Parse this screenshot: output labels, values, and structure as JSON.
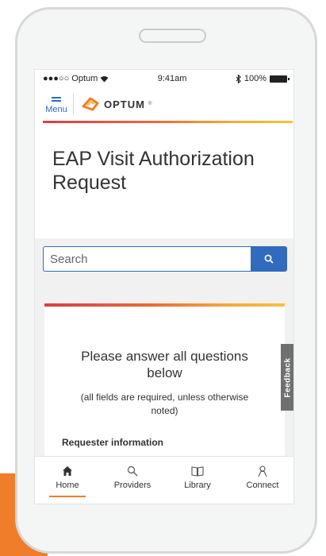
{
  "status_bar": {
    "carrier": "●●●○○ Optum",
    "time": "9:41am",
    "battery": "100%"
  },
  "header": {
    "menu_label": "Menu",
    "logo_text": "OPTUM",
    "logo_mark": "®"
  },
  "page": {
    "title": "EAP Visit Authorization Request"
  },
  "search": {
    "placeholder": "Search"
  },
  "form": {
    "heading": "Please answer all questions below",
    "note": "(all fields are required, unless otherwise noted)",
    "section": "Requester information"
  },
  "feedback": {
    "label": "Feedback"
  },
  "tabs": [
    {
      "label": "Home",
      "icon": "home-icon",
      "active": true
    },
    {
      "label": "Providers",
      "icon": "search-icon",
      "active": false
    },
    {
      "label": "Library",
      "icon": "book-icon",
      "active": false
    },
    {
      "label": "Connect",
      "icon": "person-icon",
      "active": false
    }
  ],
  "colors": {
    "accent_blue": "#316bbe",
    "accent_orange": "#ef7d2a",
    "gradient_start": "#d63e4a",
    "gradient_end": "#f4c341"
  }
}
